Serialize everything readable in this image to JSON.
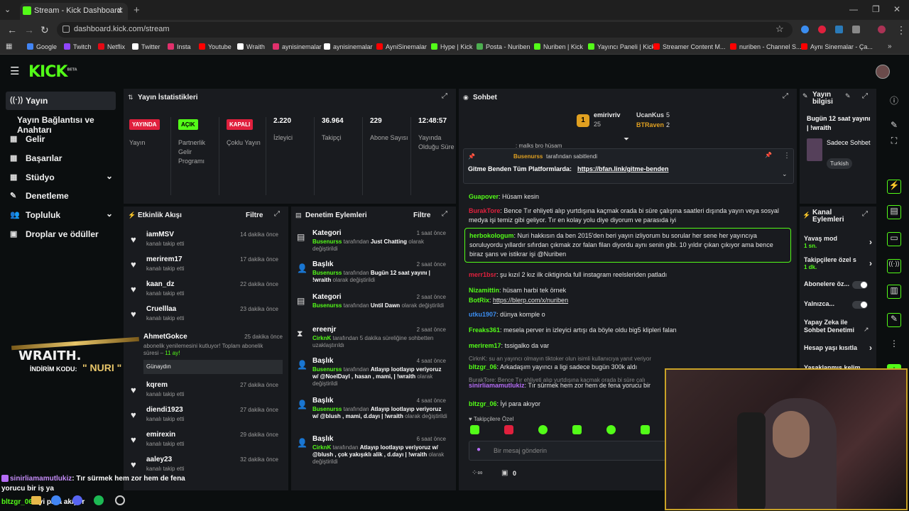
{
  "browser": {
    "tab_title": "Stream - Kick Dashboard",
    "url": "dashboard.kick.com/stream",
    "bookmarks": [
      "Google",
      "Twitch",
      "Netflix",
      "Twitter",
      "Insta",
      "Youtube",
      "Wraith",
      "aynisinemalar",
      "aynisinemalar",
      "AyniSinemalar",
      "Hype | Kick",
      "Posta - Nuriben",
      "Nuriben | Kick",
      "Yayıncı Paneli | Kick",
      "Streamer Content M...",
      "nuriben - Channel S...",
      "Aynı Sinemalar - Ça..."
    ],
    "bookmark_colors": [
      "#4285f4",
      "#9146ff",
      "#e50914",
      "#ffffff",
      "#e1306c",
      "#ff0000",
      "#ffffff",
      "#e1306c",
      "#ffffff",
      "#ff0000",
      "#53fc18",
      "#4caf50",
      "#53fc18",
      "#53fc18",
      "#ff0000",
      "#ff0000",
      "#ff0000"
    ]
  },
  "brand": {
    "logo": "KICK",
    "beta": "BETA",
    "accent": "#53fc18"
  },
  "sidebar": {
    "items": [
      {
        "label": "Yayın",
        "icon": "broadcast-icon",
        "glyph": "((·))",
        "chev": false
      },
      {
        "label": "Yayın Bağlantısı ve Anahtarı",
        "icon": "",
        "glyph": "",
        "chev": false
      },
      {
        "label": "Gelir",
        "icon": "revenue-icon",
        "glyph": "▦",
        "chev": false
      },
      {
        "label": "Başarılar",
        "icon": "achievements-icon",
        "glyph": "▦",
        "chev": false
      },
      {
        "label": "Stüdyo",
        "icon": "studio-icon",
        "glyph": "▦",
        "chev": true
      },
      {
        "label": "Denetleme",
        "icon": "wrench-icon",
        "glyph": "✎",
        "chev": false
      },
      {
        "label": "Topluluk",
        "icon": "community-icon",
        "glyph": "👥",
        "chev": true
      },
      {
        "label": "Droplar ve ödüller",
        "icon": "drops-icon",
        "glyph": "▣",
        "chev": false
      }
    ]
  },
  "stats": {
    "title": "Yayın İstatistikleri",
    "items": [
      {
        "value": "YAYINDA",
        "label": "Yayın",
        "badge": true,
        "bg": "#e0203d",
        "fg": "#fff"
      },
      {
        "value": "AÇIK",
        "label": "Partnerlik Gelir Programı",
        "badge": true,
        "bg": "#53fc18",
        "fg": "#000"
      },
      {
        "value": "KAPALI",
        "label": "Çoklu Yayın",
        "badge": true,
        "bg": "#e0203d",
        "fg": "#fff"
      },
      {
        "value": "2.220",
        "label": "İzleyici",
        "badge": false
      },
      {
        "value": "36.964",
        "label": "Takipçi",
        "badge": false
      },
      {
        "value": "229",
        "label": "Abone Sayısı",
        "badge": false
      },
      {
        "value": "12:48:57",
        "label": "Yayında Olduğu Süre",
        "badge": false
      }
    ]
  },
  "activity": {
    "title": "Etkinlik Akışı",
    "filter": "Filtre",
    "rows": [
      {
        "name": "iamMSV",
        "sub": "kanalı takip etti",
        "time": "14 dakika önce"
      },
      {
        "name": "merirem17",
        "sub": "kanalı takip etti",
        "time": "17 dakika önce"
      },
      {
        "name": "kaan_dz",
        "sub": "kanalı takip etti",
        "time": "22 dakika önce"
      },
      {
        "name": "Cruelllaa",
        "sub": "kanalı takip etti",
        "time": "23 dakika önce"
      },
      {
        "name": "kqrem",
        "sub": "kanalı takip etti",
        "time": "27 dakika önce"
      },
      {
        "name": "diendi1923",
        "sub": "kanalı takip etti",
        "time": "27 dakika önce"
      },
      {
        "name": "emirexin",
        "sub": "kanalı takip etti",
        "time": "29 dakika önce"
      },
      {
        "name": "aaley23",
        "sub": "kanalı takip etti",
        "time": "32 dakika önce"
      }
    ],
    "sub_event": {
      "name": "AhmetGokce",
      "time": "25 dakika önce",
      "text": "abonelik yenilemesini kutluyor! Toplam abonelik süresi –",
      "months": "11 ay!",
      "message": "Günaydın"
    }
  },
  "moderation": {
    "title": "Denetim Eylemleri",
    "filter": "Filtre",
    "rows": [
      {
        "type": "Kategori",
        "time": "1 saat önce",
        "actor": "Busenurss",
        "mid": "tarafından",
        "value": "Just Chatting",
        "tail": "olarak değiştirildi"
      },
      {
        "type": "Başlık",
        "time": "2 saat önce",
        "actor": "Busenurss",
        "mid": "tarafından",
        "value": "Bugün 12 saat yayını | !wraith",
        "tail": "olarak değiştirildi"
      },
      {
        "type": "Kategori",
        "time": "2 saat önce",
        "actor": "Busenurss",
        "mid": "tarafından",
        "value": "Until Dawn",
        "tail": "olarak değiştirildi"
      },
      {
        "type": "ereenjr",
        "time": "2 saat önce",
        "actor": "CirknK",
        "mid": "tarafından 5 dakika süreliğine sohbetten uzaklaştırıldı",
        "value": "",
        "tail": ""
      },
      {
        "type": "Başlık",
        "time": "4 saat önce",
        "actor": "Busenurss",
        "mid": "tarafından",
        "value": "Atlayıp lootlayıp veriyoruz w/ @NoelDayl , hasan , mami, | !wraith",
        "tail": "olarak değiştirildi"
      },
      {
        "type": "Başlık",
        "time": "4 saat önce",
        "actor": "Busenurss",
        "mid": "tarafından",
        "value": "Atlayıp lootlayıp veriyoruz w/ @blush , mami, d.dayı | !wraith",
        "tail": "olarak değiştirildi"
      },
      {
        "type": "Başlık",
        "time": "6 saat önce",
        "actor": "CirknK",
        "mid": "tarafından",
        "value": "Atlayıp lootlayıp veriyoruz w/ @blush , çok yakışıklı alik , d.dayı | !wraith",
        "tail": "olarak değiştirildi"
      }
    ]
  },
  "chat": {
    "title": "Sohbet",
    "top_gifter": {
      "name": "emirivriv",
      "rank": "1",
      "count": "25"
    },
    "others": [
      {
        "name": "UcanKus",
        "count": "5"
      },
      {
        "name": "BTRaven",
        "count": "2"
      }
    ],
    "partial_top": ": malks bro hüsam",
    "pinned": {
      "by": "Busenurss",
      "by_suffix": "tarafından sabitlendi",
      "text": "Gitme Benden Tüm Platformlarda:",
      "link": "https://bfan.link/gitme-benden"
    },
    "messages": [
      {
        "user": "Guapover",
        "color": "#53fc18",
        "text": "Hüsam kesin"
      },
      {
        "user": "BurakTore",
        "color": "#e0203d",
        "text": "Bence Tır ehliyeti alıp yurtdışına kaçmak orada bi süre çalışma saatleri dışında yayın veya sosyal medya işi temiz gibi geliyor. Tır en kolay yolu diye diyorum ve parasıda iyi"
      },
      {
        "user": "herbokologum",
        "color": "#53fc18",
        "text": "Nuri hakkısın da ben 2015'den beri yayın izliyorum bu sorular her sene her yayıncıya soruluyordu yıllardır sıfırdan çıkmak zor falan filan diyordu aynı senin gibi. 10 yıldır çıkan çıkıyor ama bence biraz şans ve istikrar işi @Nuriben"
      },
      {
        "user": "merr1bsr",
        "color": "#e0203d",
        "text": "şu kızıl 2 kız ilk ciktiginda full instagram reelsleriden patladı"
      },
      {
        "user": "Nizamittin",
        "color": "#53fc18",
        "text": "hüsam harbi tek örnek"
      },
      {
        "user": "BotRix",
        "color": "#53fc18",
        "text": "https://blerp.com/x/nuriben"
      },
      {
        "user": "utku1907",
        "color": "#3b8df0",
        "text": "dünya komple o"
      },
      {
        "user": "Freaks361",
        "color": "#53fc18",
        "text": "mesela perver in izleyici artışı da böyle oldu big5 klipleri falan"
      },
      {
        "user": "merirem17",
        "color": "#53fc18",
        "text": "tssigalko da var"
      },
      {
        "user": "bltzgr_06",
        "color": "#53fc18",
        "text": "Arkadaşım yayıncı a ligi sadece bugün 300k aldı"
      },
      {
        "user": "sinirliamamutlukiz",
        "color": "#b56cf5",
        "text": "Tır sürmek hem zor hem de fena yorucu bir"
      },
      {
        "user": "bltzgr_06",
        "color": "#53fc18",
        "text": "İyi para akıyor"
      }
    ],
    "replies": [
      "CirknK: su an yayıncı olmayın tiktoker olun isimli kullanıcıya yanıt veriyor",
      "BurakTore: Bence Tır ehliyeti alıp yurtdışına kaçmak orada bi süre çalı"
    ],
    "followers_only": "Takipçilere Özel",
    "input_placeholder": "Bir mesaj gönderin",
    "viewer_count": "0"
  },
  "info": {
    "title": "Yayın bilgisi",
    "stream_title": "Bugün 12 saat yayını | !wraith",
    "category": "Sadece Sohbet",
    "language": "Turkish"
  },
  "channel_actions": {
    "title": "Kanal Eylemleri",
    "slow_mode": "Yavaş mod",
    "slow_mode_value": "1 sn.",
    "followers_only": "Takipçilere özel s",
    "followers_only_value": "1 dk.",
    "subs_only": "Abonelere öz...",
    "emote_only": "Yalnızca...",
    "ai_mod": "Yapay Zeka ile Sohbet Denetimi",
    "account_age": "Hesap yaşı kısıtla",
    "banned": "Yasaklanmış kelim"
  },
  "overlay": {
    "brand": "WRAITH.",
    "code_label": "İNDİRİM KODU:",
    "code": "\" NURI \"",
    "chat1_user": "sinirliamamutlukiz",
    "chat1_text": ": Tır sürmek hem zor hem de fena yorucu bir iş ya",
    "chat2_user": "bltzgr_06",
    "chat2_text": ": İyi para akıyor"
  }
}
